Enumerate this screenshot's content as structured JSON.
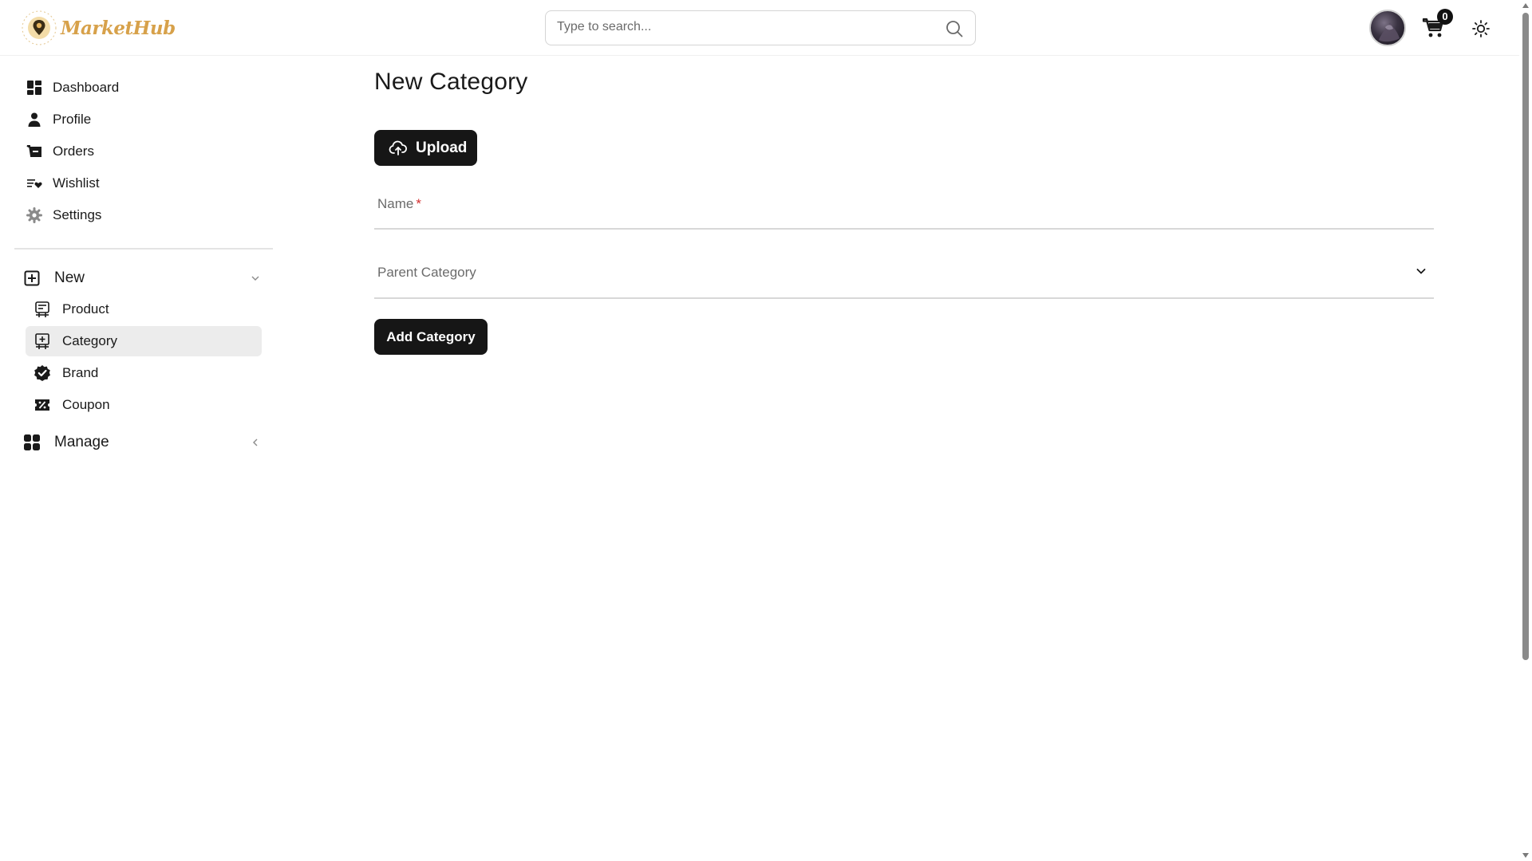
{
  "header": {
    "brand": "MarketHub",
    "logo_ring_text": "Market Hub",
    "search_placeholder": "Type to search...",
    "cart_count": "0",
    "icons": {
      "search": "search-icon",
      "cart": "cart-icon",
      "theme": "sun-icon",
      "avatar": "avatar"
    }
  },
  "sidebar": {
    "items": [
      {
        "label": "Dashboard",
        "icon": "dashboard-icon"
      },
      {
        "label": "Profile",
        "icon": "user-icon"
      },
      {
        "label": "Orders",
        "icon": "orders-basket-icon"
      },
      {
        "label": "Wishlist",
        "icon": "wishlist-icon"
      },
      {
        "label": "Settings",
        "icon": "gear-icon"
      }
    ],
    "groups": [
      {
        "label": "New",
        "icon": "plus-square-icon",
        "expanded": true,
        "items": [
          {
            "label": "Product",
            "icon": "product-icon",
            "active": false
          },
          {
            "label": "Category",
            "icon": "category-icon",
            "active": true
          },
          {
            "label": "Brand",
            "icon": "badge-check-icon",
            "active": false
          },
          {
            "label": "Coupon",
            "icon": "coupon-icon",
            "active": false
          }
        ]
      },
      {
        "label": "Manage",
        "icon": "grid-icon",
        "expanded": false
      }
    ]
  },
  "main": {
    "title": "New Category",
    "upload_label": "Upload",
    "name_label": "Name",
    "name_required_mark": "*",
    "parent_label": "Parent Category",
    "submit_label": "Add Category"
  },
  "colors": {
    "brand": "#d7a14a",
    "button_bg": "#161616",
    "active_item_bg": "#ececec",
    "required": "#d32f2f"
  }
}
